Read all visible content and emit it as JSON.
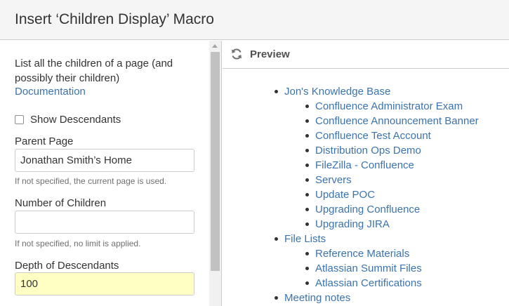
{
  "dialog": {
    "title": "Insert ‘Children Display’ Macro"
  },
  "left_panel": {
    "description": "List all the children of a page (and possibly their children)",
    "documentation_link": "Documentation",
    "show_descendants": {
      "label": "Show Descendants",
      "checked": false
    },
    "parent_page": {
      "label": "Parent Page",
      "value": "Jonathan Smith’s Home",
      "hint": "If not specified, the current page is used."
    },
    "number_of_children": {
      "label": "Number of Children",
      "value": "",
      "hint": "If not specified, no limit is applied."
    },
    "depth_of_descendants": {
      "label": "Depth of Descendants",
      "value": "100"
    }
  },
  "preview": {
    "label": "Preview",
    "icon": "refresh-icon",
    "tree": [
      {
        "title": "Jon's Knowledge Base",
        "children": [
          "Confluence Administrator Exam",
          "Confluence Announcement Banner",
          "Confluence Test Account",
          "Distribution Ops Demo",
          "FileZilla - Confluence",
          "Servers",
          "Update POC",
          "Upgrading Confluence",
          "Upgrading JIRA"
        ]
      },
      {
        "title": "File Lists",
        "children": [
          "Reference Materials",
          "Atlassian Summit Files",
          "Atlassian Certifications"
        ]
      },
      {
        "title": "Meeting notes",
        "children": []
      }
    ]
  },
  "colors": {
    "link": "#3b73af",
    "header_bg": "#f5f5f5",
    "highlight_input": "#ffffc4"
  }
}
